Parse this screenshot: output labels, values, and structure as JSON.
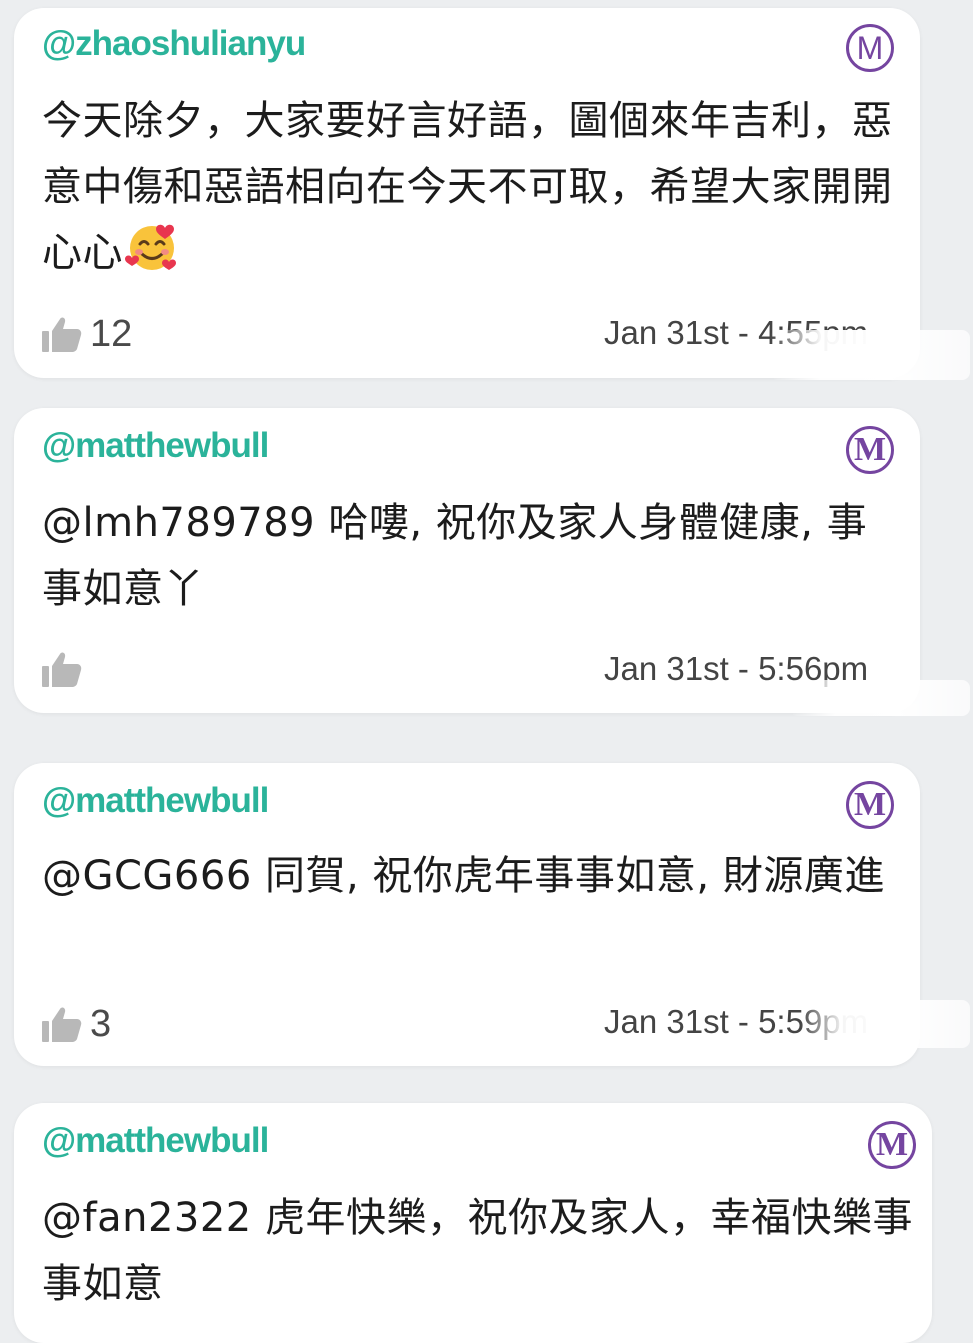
{
  "comments": [
    {
      "username": "@zhaoshulianyu",
      "badge_letter": "M",
      "text": "今天除夕，大家要好言好語，圖個來年吉利，惡意中傷和惡語相向在今天不可取，希望大家開開心心",
      "emoji": "smiling-face-with-hearts",
      "likes": "12",
      "timestamp": "Jan 31st - 4:55pm"
    },
    {
      "username": "@matthewbull",
      "badge_letter": "M",
      "text": "@lmh789789 哈嘍, 祝你及家人身體健康, 事事如意丫",
      "likes": "",
      "timestamp": "Jan 31st - 5:56pm"
    },
    {
      "username": "@matthewbull",
      "badge_letter": "M",
      "text": "@GCG666 同賀, 祝你虎年事事如意, 財源廣進",
      "likes": "3",
      "timestamp": "Jan 31st - 5:59pm"
    },
    {
      "username": "@matthewbull",
      "badge_letter": "M",
      "text": "@fan2322 虎年快樂，祝你及家人，幸福快樂事事如意"
    }
  ],
  "colors": {
    "username": "#2bb39a",
    "badge": "#7545a0",
    "text": "#1c1c1c",
    "meta": "#444444",
    "background": "#eceef0"
  },
  "icons": {
    "like": "thumbs-up-icon",
    "badge": "m-circle-icon"
  }
}
